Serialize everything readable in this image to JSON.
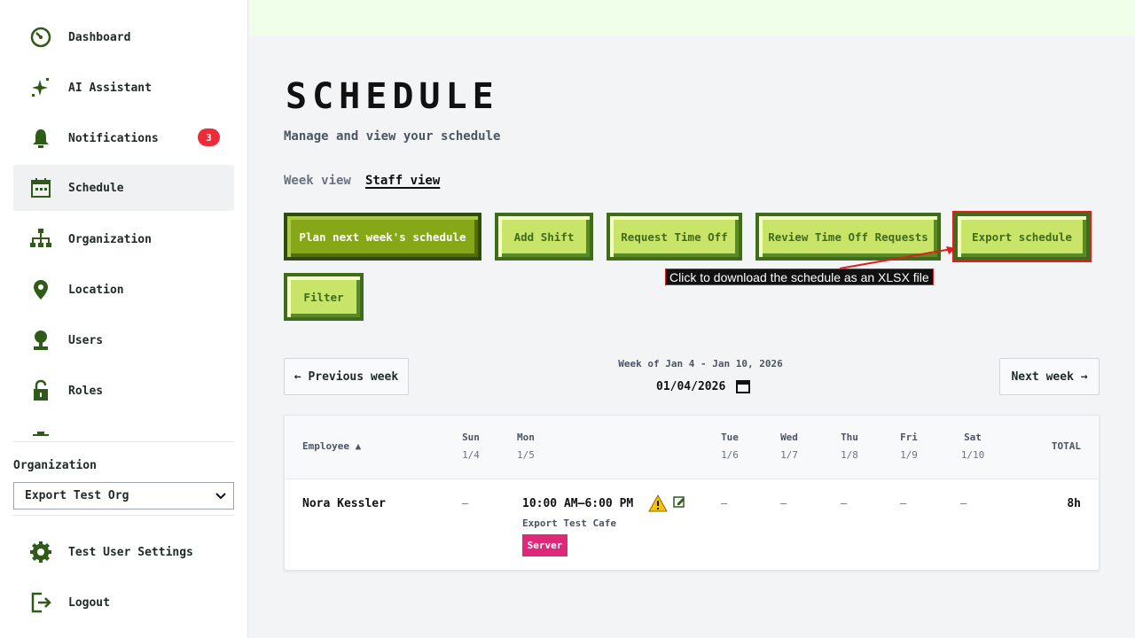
{
  "sidebar": {
    "items": [
      {
        "label": "Dashboard",
        "icon": "dashboard-icon"
      },
      {
        "label": "AI Assistant",
        "icon": "sparkle-icon"
      },
      {
        "label": "Notifications",
        "icon": "bell-icon",
        "badge": "3"
      },
      {
        "label": "Schedule",
        "icon": "calendar-icon",
        "active": true
      },
      {
        "label": "Organization",
        "icon": "org-chart-icon"
      },
      {
        "label": "Location",
        "icon": "map-pin-icon"
      },
      {
        "label": "Users",
        "icon": "user-icon"
      },
      {
        "label": "Roles",
        "icon": "lock-icon"
      }
    ],
    "organization_label": "Organization",
    "organization_value": "Export Test Org",
    "settings_label": "Test User Settings",
    "logout_label": "Logout"
  },
  "page": {
    "title": "SCHEDULE",
    "subtitle": "Manage and view your schedule",
    "tabs": {
      "week": "Week view",
      "staff": "Staff view"
    }
  },
  "actions": {
    "plan": "Plan next week's schedule",
    "add_shift": "Add Shift",
    "request_time_off": "Request Time Off",
    "review_time_off": "Review Time Off Requests",
    "export": "Export schedule",
    "filter": "Filter",
    "tooltip": "Click to download the schedule as an XLSX file"
  },
  "week": {
    "previous": "← Previous week",
    "next": "Next week →",
    "range": "Week of Jan 4 - Jan 10, 2026",
    "date_value": "01/04/2026"
  },
  "table": {
    "employee_header": "Employee ▲",
    "total_header": "TOTAL",
    "days": [
      {
        "name": "Sun",
        "date": "1/4"
      },
      {
        "name": "Mon",
        "date": "1/5"
      },
      {
        "name": "Tue",
        "date": "1/6"
      },
      {
        "name": "Wed",
        "date": "1/7"
      },
      {
        "name": "Thu",
        "date": "1/8"
      },
      {
        "name": "Fri",
        "date": "1/9"
      },
      {
        "name": "Sat",
        "date": "1/10"
      }
    ],
    "rows": [
      {
        "employee": "Nora Kessler",
        "empty": "–",
        "shift_time": "10:00 AM–6:00 PM",
        "shift_location": "Export Test Cafe",
        "shift_role": "Server",
        "total": "8h"
      }
    ]
  },
  "colors": {
    "accent_green": "#c8e56a",
    "dark_green": "#3f6b1c",
    "primary_green": "#86a818",
    "badge_red": "#ef2b3a",
    "role_pink": "#e0287a"
  }
}
